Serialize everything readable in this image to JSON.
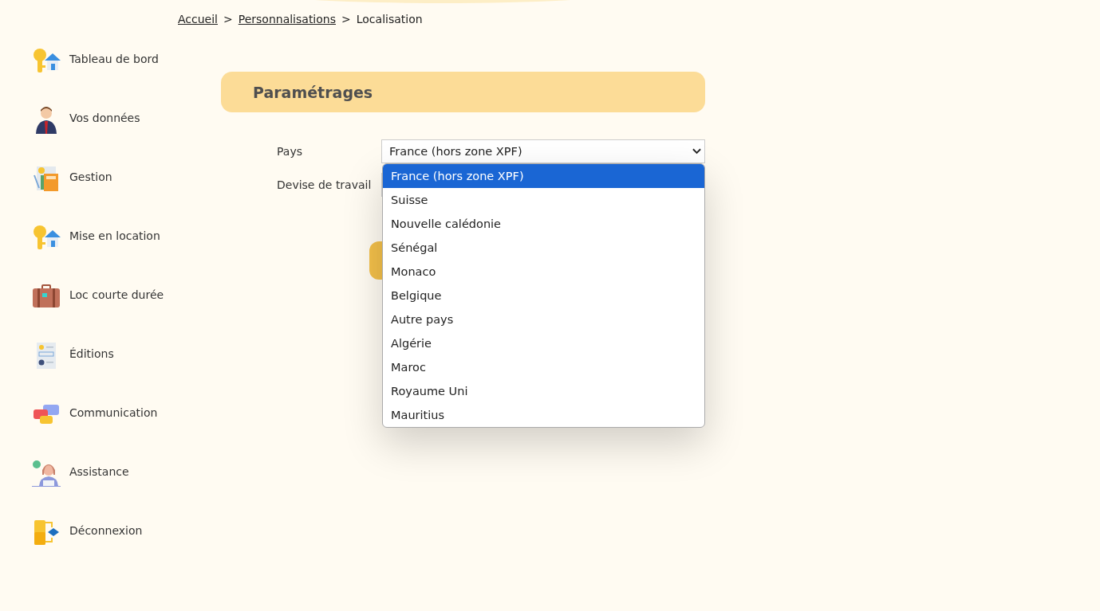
{
  "breadcrumb": [
    {
      "label": "Accueil",
      "kind": "link"
    },
    {
      "label": "Personnalisations",
      "kind": "link"
    },
    {
      "label": "Localisation",
      "kind": "current"
    }
  ],
  "breadcrumb_separator": ">",
  "sidebar": {
    "items": [
      {
        "label": "Tableau de bord",
        "kind": "key-house"
      },
      {
        "label": "Vos données",
        "kind": "person"
      },
      {
        "label": "Gestion",
        "kind": "calculator"
      },
      {
        "label": "Mise en location",
        "kind": "key-house"
      },
      {
        "label": "Loc courte durée",
        "kind": "suitcase"
      },
      {
        "label": "Éditions",
        "kind": "report"
      },
      {
        "label": "Communication",
        "kind": "chat"
      },
      {
        "label": "Assistance",
        "kind": "support"
      },
      {
        "label": "Déconnexion",
        "kind": "exit"
      }
    ]
  },
  "panel": {
    "title": "Paramétrages"
  },
  "form": {
    "fields": [
      {
        "label": "Pays",
        "kind": "select",
        "value": "France (hors zone XPF)",
        "expanded": true
      },
      {
        "label": "Devise de travail",
        "kind": "covered"
      }
    ]
  },
  "dropdown": {
    "options": [
      {
        "label": "France (hors zone XPF)",
        "selected": true
      },
      {
        "label": "Suisse",
        "selected": false
      },
      {
        "label": "Nouvelle calédonie",
        "selected": false
      },
      {
        "label": "Sénégal",
        "selected": false
      },
      {
        "label": "Monaco",
        "selected": false
      },
      {
        "label": "Belgique",
        "selected": false
      },
      {
        "label": "Autre pays",
        "selected": false
      },
      {
        "label": "Algérie",
        "selected": false
      },
      {
        "label": "Maroc",
        "selected": false
      },
      {
        "label": "Royaume Uni",
        "selected": false
      },
      {
        "label": "Mauritius",
        "selected": false
      }
    ]
  }
}
